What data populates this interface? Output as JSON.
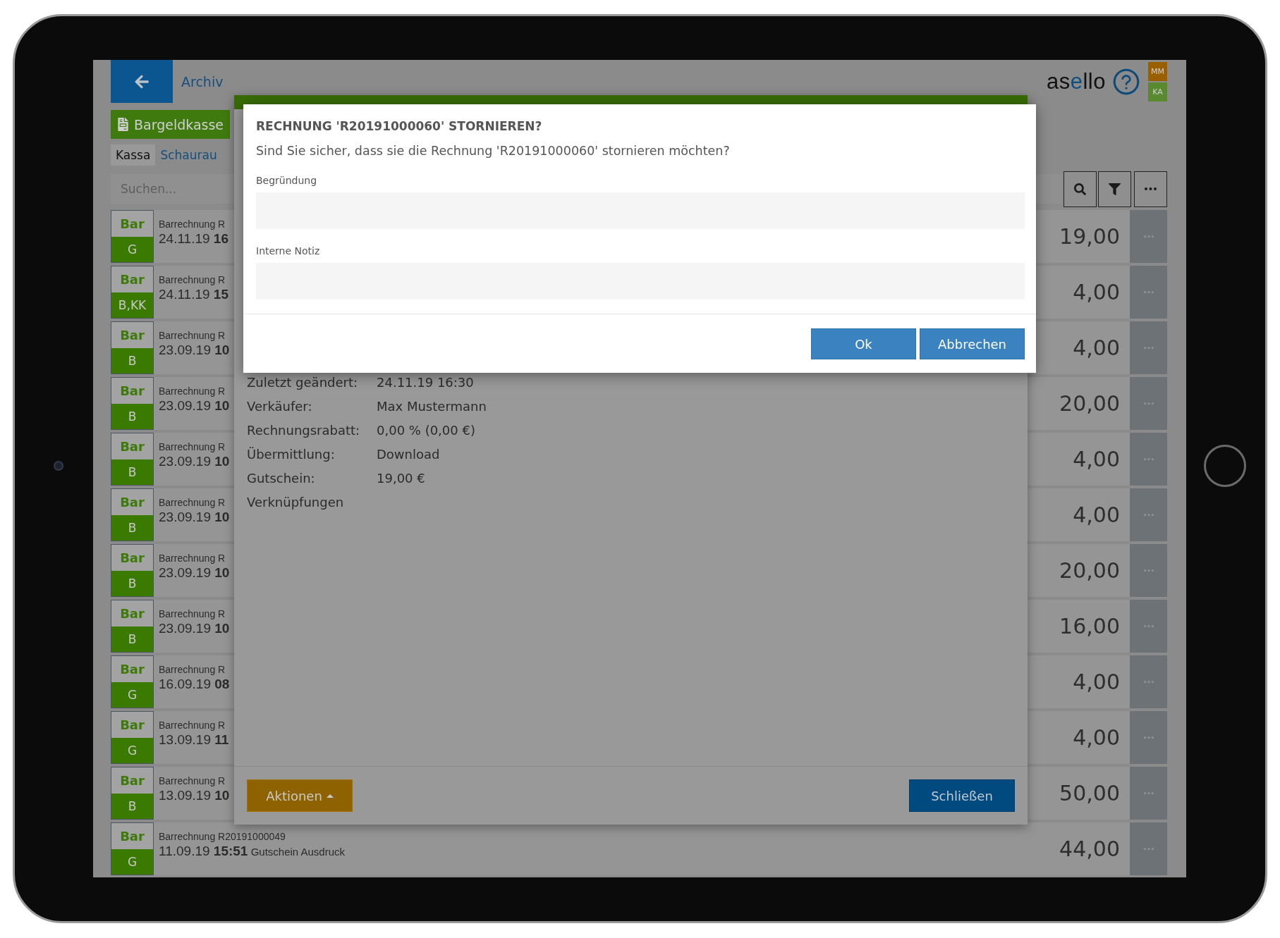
{
  "header": {
    "back_title": "Archiv",
    "logo": [
      {
        "text": "as",
        "accent": false
      },
      {
        "text": "e",
        "accent": true
      },
      {
        "text": "llo",
        "accent": false
      }
    ],
    "users": [
      {
        "initials": "MM",
        "color": "#9a5f00"
      },
      {
        "initials": "KA",
        "color": "#5a8a30"
      }
    ]
  },
  "register_button": "Bargeldkasse",
  "tabs": [
    {
      "label": "Kassa",
      "selected": true
    },
    {
      "label": "Schaurau",
      "selected": false
    }
  ],
  "search": {
    "placeholder": "Suchen..."
  },
  "rows": [
    {
      "method": "Bar",
      "tag": "G",
      "title": "Barrechnung R",
      "date": "24.11.19",
      "time": "16",
      "amount": "19,00"
    },
    {
      "method": "Bar",
      "tag": "B,KK",
      "title": "Barrechnung R",
      "date": "24.11.19",
      "time": "15",
      "amount": "4,00"
    },
    {
      "method": "Bar",
      "tag": "B",
      "title": "Barrechnung R",
      "date": "23.09.19",
      "time": "10",
      "amount": "4,00"
    },
    {
      "method": "Bar",
      "tag": "B",
      "title": "Barrechnung R",
      "date": "23.09.19",
      "time": "10",
      "amount": "20,00"
    },
    {
      "method": "Bar",
      "tag": "B",
      "title": "Barrechnung R",
      "date": "23.09.19",
      "time": "10",
      "amount": "4,00"
    },
    {
      "method": "Bar",
      "tag": "B",
      "title": "Barrechnung R",
      "date": "23.09.19",
      "time": "10",
      "amount": "4,00"
    },
    {
      "method": "Bar",
      "tag": "B",
      "title": "Barrechnung R",
      "date": "23.09.19",
      "time": "10",
      "amount": "20,00"
    },
    {
      "method": "Bar",
      "tag": "B",
      "title": "Barrechnung R",
      "date": "23.09.19",
      "time": "10",
      "amount": "16,00"
    },
    {
      "method": "Bar",
      "tag": "G",
      "title": "Barrechnung R",
      "date": "16.09.19",
      "time": "08",
      "amount": "4,00"
    },
    {
      "method": "Bar",
      "tag": "G",
      "title": "Barrechnung R",
      "date": "13.09.19",
      "time": "11",
      "amount": "4,00"
    },
    {
      "method": "Bar",
      "tag": "B",
      "title": "Barrechnung R",
      "date": "13.09.19",
      "time": "10",
      "amount": "50,00"
    },
    {
      "method": "Bar",
      "tag": "G",
      "title": "Barrechnung R20191000049",
      "date": "11.09.19",
      "time": "15:51",
      "note": "Gutschein Ausdruck",
      "amount": "44,00"
    }
  ],
  "detail": {
    "fields": [
      {
        "label": "Zuletzt geändert:",
        "value": "24.11.19 16:30"
      },
      {
        "label": "Verkäufer:",
        "value": "Max Mustermann"
      },
      {
        "label": "Rechnungsrabatt:",
        "value": "0,00 % (0,00 €)"
      },
      {
        "label": "Übermittlung:",
        "value": "Download"
      },
      {
        "label": "Gutschein:",
        "value": "19,00 €"
      }
    ],
    "section": "Verknüpfungen",
    "actions_button": "Aktionen",
    "close_button": "Schließen"
  },
  "dialog": {
    "title": "RECHNUNG 'R20191000060' STORNIEREN?",
    "message": "Sind Sie sicher, dass sie die Rechnung 'R20191000060' stornieren möchten?",
    "fields": [
      {
        "label": "Begründung"
      },
      {
        "label": "Interne Notiz"
      }
    ],
    "buttons": [
      "Ok",
      "Abbrechen"
    ]
  }
}
